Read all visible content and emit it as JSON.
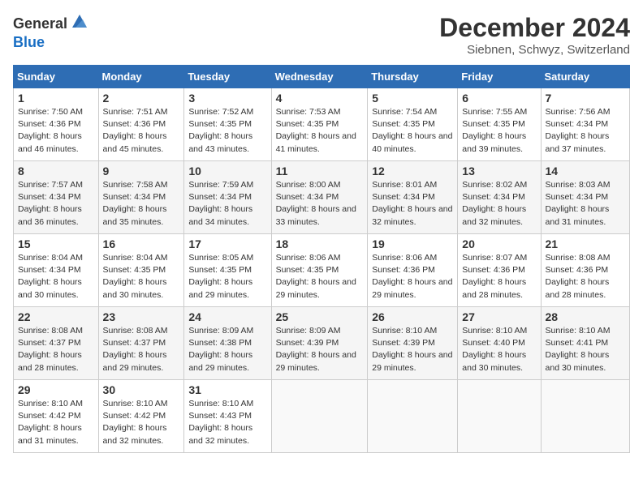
{
  "logo": {
    "general": "General",
    "blue": "Blue"
  },
  "title": "December 2024",
  "location": "Siebnen, Schwyz, Switzerland",
  "headers": [
    "Sunday",
    "Monday",
    "Tuesday",
    "Wednesday",
    "Thursday",
    "Friday",
    "Saturday"
  ],
  "weeks": [
    [
      {
        "day": "1",
        "sunrise": "Sunrise: 7:50 AM",
        "sunset": "Sunset: 4:36 PM",
        "daylight": "Daylight: 8 hours and 46 minutes."
      },
      {
        "day": "2",
        "sunrise": "Sunrise: 7:51 AM",
        "sunset": "Sunset: 4:36 PM",
        "daylight": "Daylight: 8 hours and 45 minutes."
      },
      {
        "day": "3",
        "sunrise": "Sunrise: 7:52 AM",
        "sunset": "Sunset: 4:35 PM",
        "daylight": "Daylight: 8 hours and 43 minutes."
      },
      {
        "day": "4",
        "sunrise": "Sunrise: 7:53 AM",
        "sunset": "Sunset: 4:35 PM",
        "daylight": "Daylight: 8 hours and 41 minutes."
      },
      {
        "day": "5",
        "sunrise": "Sunrise: 7:54 AM",
        "sunset": "Sunset: 4:35 PM",
        "daylight": "Daylight: 8 hours and 40 minutes."
      },
      {
        "day": "6",
        "sunrise": "Sunrise: 7:55 AM",
        "sunset": "Sunset: 4:35 PM",
        "daylight": "Daylight: 8 hours and 39 minutes."
      },
      {
        "day": "7",
        "sunrise": "Sunrise: 7:56 AM",
        "sunset": "Sunset: 4:34 PM",
        "daylight": "Daylight: 8 hours and 37 minutes."
      }
    ],
    [
      {
        "day": "8",
        "sunrise": "Sunrise: 7:57 AM",
        "sunset": "Sunset: 4:34 PM",
        "daylight": "Daylight: 8 hours and 36 minutes."
      },
      {
        "day": "9",
        "sunrise": "Sunrise: 7:58 AM",
        "sunset": "Sunset: 4:34 PM",
        "daylight": "Daylight: 8 hours and 35 minutes."
      },
      {
        "day": "10",
        "sunrise": "Sunrise: 7:59 AM",
        "sunset": "Sunset: 4:34 PM",
        "daylight": "Daylight: 8 hours and 34 minutes."
      },
      {
        "day": "11",
        "sunrise": "Sunrise: 8:00 AM",
        "sunset": "Sunset: 4:34 PM",
        "daylight": "Daylight: 8 hours and 33 minutes."
      },
      {
        "day": "12",
        "sunrise": "Sunrise: 8:01 AM",
        "sunset": "Sunset: 4:34 PM",
        "daylight": "Daylight: 8 hours and 32 minutes."
      },
      {
        "day": "13",
        "sunrise": "Sunrise: 8:02 AM",
        "sunset": "Sunset: 4:34 PM",
        "daylight": "Daylight: 8 hours and 32 minutes."
      },
      {
        "day": "14",
        "sunrise": "Sunrise: 8:03 AM",
        "sunset": "Sunset: 4:34 PM",
        "daylight": "Daylight: 8 hours and 31 minutes."
      }
    ],
    [
      {
        "day": "15",
        "sunrise": "Sunrise: 8:04 AM",
        "sunset": "Sunset: 4:34 PM",
        "daylight": "Daylight: 8 hours and 30 minutes."
      },
      {
        "day": "16",
        "sunrise": "Sunrise: 8:04 AM",
        "sunset": "Sunset: 4:35 PM",
        "daylight": "Daylight: 8 hours and 30 minutes."
      },
      {
        "day": "17",
        "sunrise": "Sunrise: 8:05 AM",
        "sunset": "Sunset: 4:35 PM",
        "daylight": "Daylight: 8 hours and 29 minutes."
      },
      {
        "day": "18",
        "sunrise": "Sunrise: 8:06 AM",
        "sunset": "Sunset: 4:35 PM",
        "daylight": "Daylight: 8 hours and 29 minutes."
      },
      {
        "day": "19",
        "sunrise": "Sunrise: 8:06 AM",
        "sunset": "Sunset: 4:36 PM",
        "daylight": "Daylight: 8 hours and 29 minutes."
      },
      {
        "day": "20",
        "sunrise": "Sunrise: 8:07 AM",
        "sunset": "Sunset: 4:36 PM",
        "daylight": "Daylight: 8 hours and 28 minutes."
      },
      {
        "day": "21",
        "sunrise": "Sunrise: 8:08 AM",
        "sunset": "Sunset: 4:36 PM",
        "daylight": "Daylight: 8 hours and 28 minutes."
      }
    ],
    [
      {
        "day": "22",
        "sunrise": "Sunrise: 8:08 AM",
        "sunset": "Sunset: 4:37 PM",
        "daylight": "Daylight: 8 hours and 28 minutes."
      },
      {
        "day": "23",
        "sunrise": "Sunrise: 8:08 AM",
        "sunset": "Sunset: 4:37 PM",
        "daylight": "Daylight: 8 hours and 29 minutes."
      },
      {
        "day": "24",
        "sunrise": "Sunrise: 8:09 AM",
        "sunset": "Sunset: 4:38 PM",
        "daylight": "Daylight: 8 hours and 29 minutes."
      },
      {
        "day": "25",
        "sunrise": "Sunrise: 8:09 AM",
        "sunset": "Sunset: 4:39 PM",
        "daylight": "Daylight: 8 hours and 29 minutes."
      },
      {
        "day": "26",
        "sunrise": "Sunrise: 8:10 AM",
        "sunset": "Sunset: 4:39 PM",
        "daylight": "Daylight: 8 hours and 29 minutes."
      },
      {
        "day": "27",
        "sunrise": "Sunrise: 8:10 AM",
        "sunset": "Sunset: 4:40 PM",
        "daylight": "Daylight: 8 hours and 30 minutes."
      },
      {
        "day": "28",
        "sunrise": "Sunrise: 8:10 AM",
        "sunset": "Sunset: 4:41 PM",
        "daylight": "Daylight: 8 hours and 30 minutes."
      }
    ],
    [
      {
        "day": "29",
        "sunrise": "Sunrise: 8:10 AM",
        "sunset": "Sunset: 4:42 PM",
        "daylight": "Daylight: 8 hours and 31 minutes."
      },
      {
        "day": "30",
        "sunrise": "Sunrise: 8:10 AM",
        "sunset": "Sunset: 4:42 PM",
        "daylight": "Daylight: 8 hours and 32 minutes."
      },
      {
        "day": "31",
        "sunrise": "Sunrise: 8:10 AM",
        "sunset": "Sunset: 4:43 PM",
        "daylight": "Daylight: 8 hours and 32 minutes."
      },
      null,
      null,
      null,
      null
    ]
  ]
}
